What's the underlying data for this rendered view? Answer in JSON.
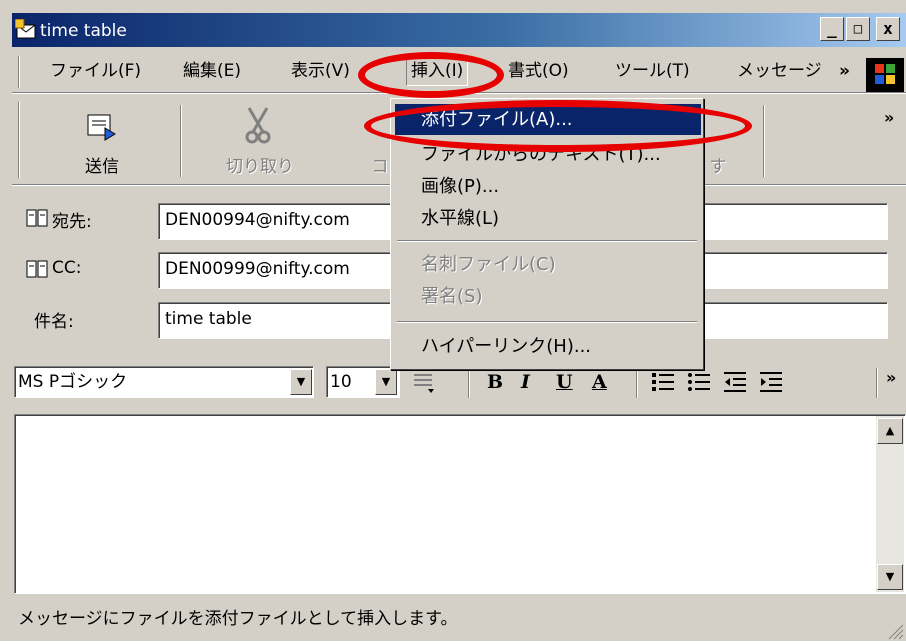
{
  "window": {
    "title": "time table",
    "min_glyph": "_",
    "max_glyph": "□",
    "close_glyph": "x"
  },
  "menubar": {
    "items": [
      "ファイル(F)",
      "編集(E)",
      "表示(V)",
      "挿入(I)",
      "書式(O)",
      "ツール(T)",
      "メッセージ"
    ],
    "overflow": "»"
  },
  "toolbar": {
    "send_label": "送信",
    "cut_label": "切り取り",
    "copy_label_partial": "コ",
    "paste_label_partial": "す",
    "overflow": "»"
  },
  "header_fields": {
    "to_label": "宛先:",
    "to_value": "DEN00994@nifty.com",
    "cc_label": "CC:",
    "cc_value": "DEN00999@nifty.com",
    "subject_label": "件名:",
    "subject_value": "time table"
  },
  "format_bar": {
    "font_name": "MS Pゴシック",
    "font_size": "10",
    "bold": "B",
    "italic": "I",
    "underline": "U",
    "color": "A",
    "overflow": "»"
  },
  "insert_menu": {
    "items": [
      {
        "label": "添付ファイル(A)...",
        "state": "selected"
      },
      {
        "label": "ファイルからのテキスト(T)...",
        "state": "normal"
      },
      {
        "label": "画像(P)...",
        "state": "normal"
      },
      {
        "label": "水平線(L)",
        "state": "normal"
      },
      {
        "label": "名刺ファイル(C)",
        "state": "disabled"
      },
      {
        "label": "署名(S)",
        "state": "disabled"
      },
      {
        "label": "ハイパーリンク(H)...",
        "state": "normal"
      }
    ]
  },
  "statusbar": {
    "text": "メッセージにファイルを添付ファイルとして挿入します。"
  },
  "colors": {
    "title_start": "#0a246a",
    "title_end": "#a6caf0",
    "chrome": "#d4d0c8",
    "highlight": "#0a246a",
    "annotation_red": "#e60000"
  }
}
